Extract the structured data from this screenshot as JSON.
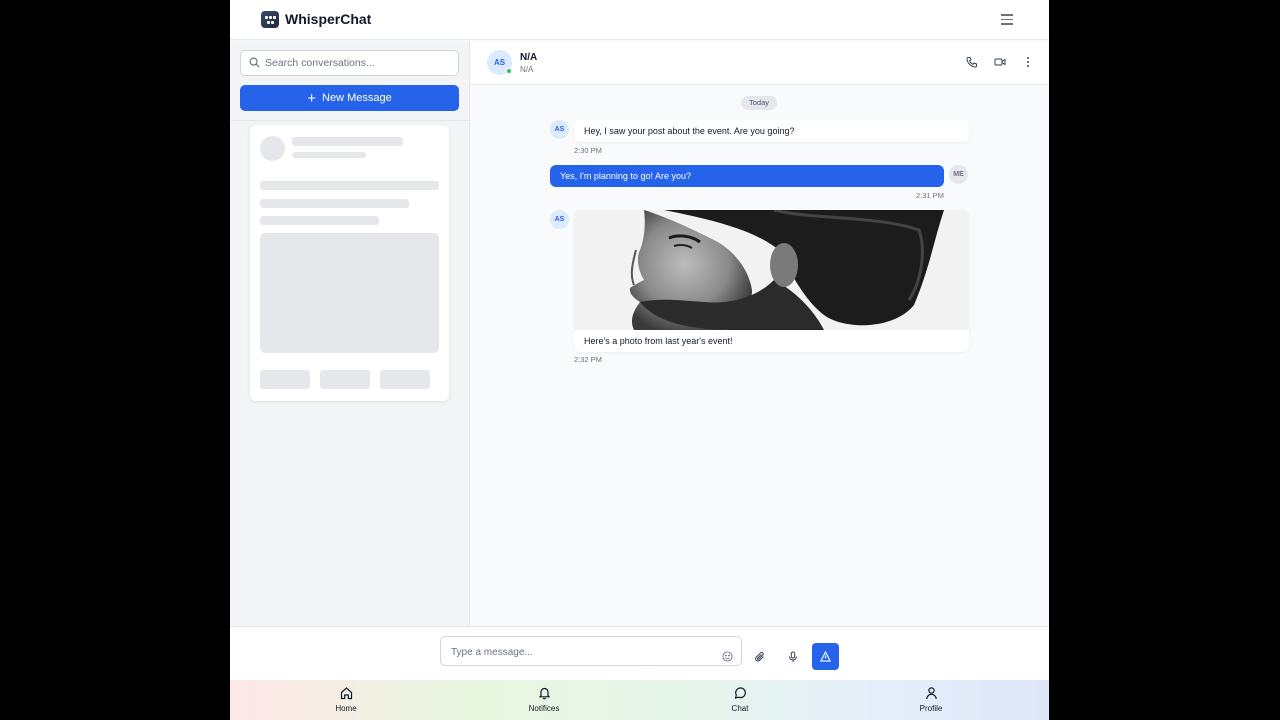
{
  "app": {
    "name": "WhisperChat"
  },
  "sidebar": {
    "search_placeholder": "Search conversations...",
    "new_message_label": "New Message"
  },
  "chat": {
    "contact": {
      "initials": "AS",
      "name": "N/A",
      "status": "N/A",
      "online": true
    },
    "date_divider": "Today",
    "messages": [
      {
        "from": "AS",
        "text": "Hey, I saw your post about the event. Are you going?",
        "time": "2:30 PM"
      },
      {
        "from": "ME",
        "text": "Yes, I'm planning to go! Are you?",
        "time": "2:31 PM"
      },
      {
        "from": "AS",
        "image": "photo-of-curly-haired-bearded-man",
        "text": "Here's a photo from last year's event!",
        "time": "2:32 PM"
      }
    ]
  },
  "composer": {
    "placeholder": "Type a message..."
  },
  "bottom_nav": [
    {
      "label": "Home",
      "icon": "home-icon"
    },
    {
      "label": "Notifices",
      "icon": "bell-icon"
    },
    {
      "label": "Chat",
      "icon": "chat-icon"
    },
    {
      "label": "Profile",
      "icon": "user-icon"
    }
  ],
  "colors": {
    "accent": "#2563eb",
    "online": "#22c55e"
  }
}
